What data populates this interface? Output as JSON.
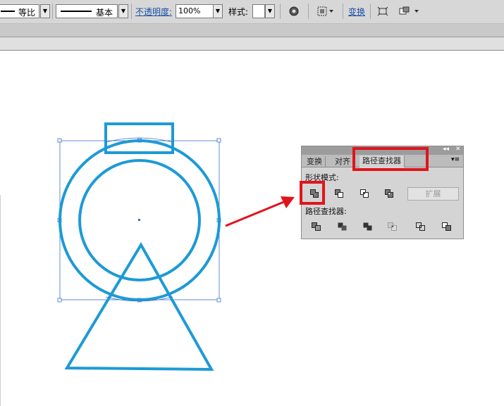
{
  "toolbar": {
    "ratio_label": "等比",
    "stroke_profile_label": "基本",
    "opacity_link": "不透明度:",
    "opacity_value": "100%",
    "style_label": "样式:",
    "transform_link": "变换"
  },
  "panel": {
    "tabs": [
      {
        "label": "变换"
      },
      {
        "label": "对齐"
      },
      {
        "label": "路径查找器"
      }
    ],
    "shape_modes_label": "形状模式:",
    "expand_label": "扩展",
    "pathfinders_label": "路径查找器:",
    "shape_mode_buttons": [
      "unite-icon",
      "minus-front-icon",
      "intersect-icon",
      "exclude-icon"
    ],
    "pathfinder_buttons": [
      "divide-icon",
      "trim-icon",
      "merge-icon",
      "crop-icon",
      "outline-icon",
      "minus-back-icon"
    ]
  },
  "colors": {
    "shape_stroke": "#1d9ad6",
    "selection": "#3a6fd0",
    "highlight": "#e0151b"
  }
}
